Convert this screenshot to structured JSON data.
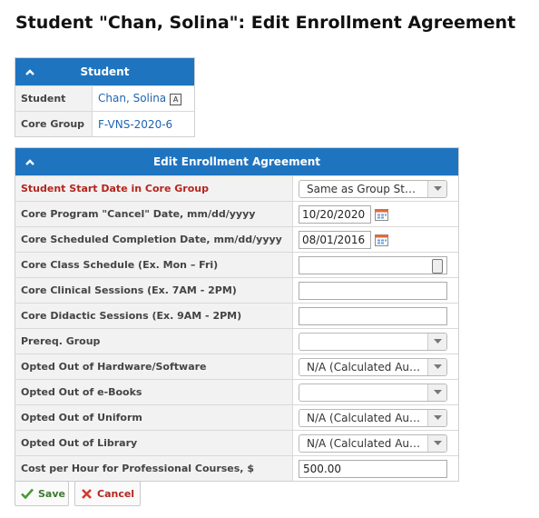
{
  "page": {
    "title": "Student \"Chan, Solina\": Edit Enrollment Agreement"
  },
  "student_panel": {
    "header": "Student",
    "rows": [
      {
        "label": "Student",
        "value": "Chan, Solina",
        "badge": "A"
      },
      {
        "label": "Core Group",
        "value": "F-VNS-2020-6"
      }
    ]
  },
  "edit_panel": {
    "header": "Edit Enrollment Agreement",
    "fields": {
      "start_date": {
        "label": "Student Start Date in Core Group",
        "value": "Same as Group Sta..."
      },
      "cancel_date": {
        "label": "Core Program \"Cancel\" Date, mm/dd/yyyy",
        "value": "10/20/2020"
      },
      "completion_date": {
        "label": "Core Scheduled Completion Date, mm/dd/yyyy",
        "value": "08/01/2016"
      },
      "class_schedule": {
        "label": "Core Class Schedule (Ex. Mon – Fri)",
        "value": ""
      },
      "clinical_sessions": {
        "label": "Core Clinical Sessions (Ex. 7AM - 2PM)",
        "value": ""
      },
      "didactic_sessions": {
        "label": "Core Didactic Sessions (Ex. 9AM - 2PM)",
        "value": ""
      },
      "prereq_group": {
        "label": "Prereq. Group",
        "value": ""
      },
      "hardware_software": {
        "label": "Opted Out of Hardware/Software",
        "value": "N/A (Calculated Aut..."
      },
      "ebooks": {
        "label": "Opted Out of e-Books",
        "value": ""
      },
      "uniform": {
        "label": "Opted Out of Uniform",
        "value": "N/A (Calculated Aut..."
      },
      "library": {
        "label": "Opted Out of Library",
        "value": "N/A (Calculated Aut..."
      },
      "cost_per_hour": {
        "label": "Cost per Hour for Professional Courses, $",
        "value": "500.00"
      }
    }
  },
  "actions": {
    "save_label": "Save",
    "cancel_label": "Cancel"
  },
  "colors": {
    "header_blue": "#1f74c0",
    "required_red": "#b3261e",
    "save_green": "#3c7a2f"
  }
}
